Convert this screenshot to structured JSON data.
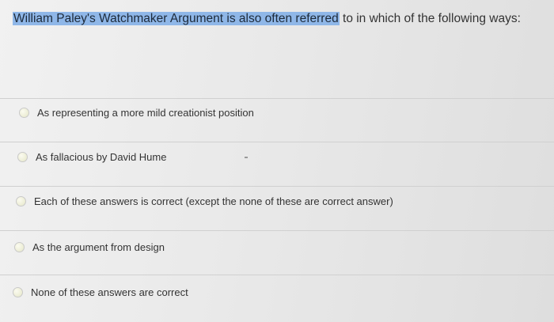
{
  "question": {
    "highlighted": "William Paley's Watchmaker Argument is also often referred",
    "rest": " to in which of the following ways:"
  },
  "options": [
    {
      "label": "As representing a more mild creationist position"
    },
    {
      "label": "As fallacious by David Hume"
    },
    {
      "label": "Each of these answers is correct (except the none of these are correct answer)"
    },
    {
      "label": "As the argument from design"
    },
    {
      "label": "None of these answers are correct"
    }
  ]
}
